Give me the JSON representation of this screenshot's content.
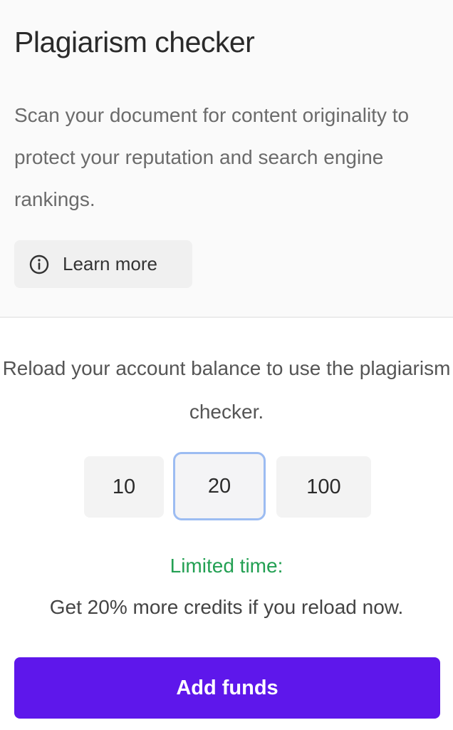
{
  "panel": {
    "title": "Plagiarism checker",
    "description": "Scan your document for content originality to protect your reputation and search engine rankings.",
    "learn_more": {
      "label": "Learn more",
      "icon": "info-icon"
    }
  },
  "reload": {
    "message": "Reload your account balance to use the plagiarism checker.",
    "amounts": [
      {
        "label": "10",
        "selected": false
      },
      {
        "label": "20",
        "selected": true
      },
      {
        "label": "100",
        "selected": false
      }
    ]
  },
  "promo": {
    "title": "Limited time:",
    "text": "Get 20% more credits if you reload now."
  },
  "actions": {
    "add_funds_label": "Add funds"
  },
  "colors": {
    "accent": "#5e17eb",
    "promo_green": "#23a053",
    "selected_border": "#9cbcf2"
  }
}
